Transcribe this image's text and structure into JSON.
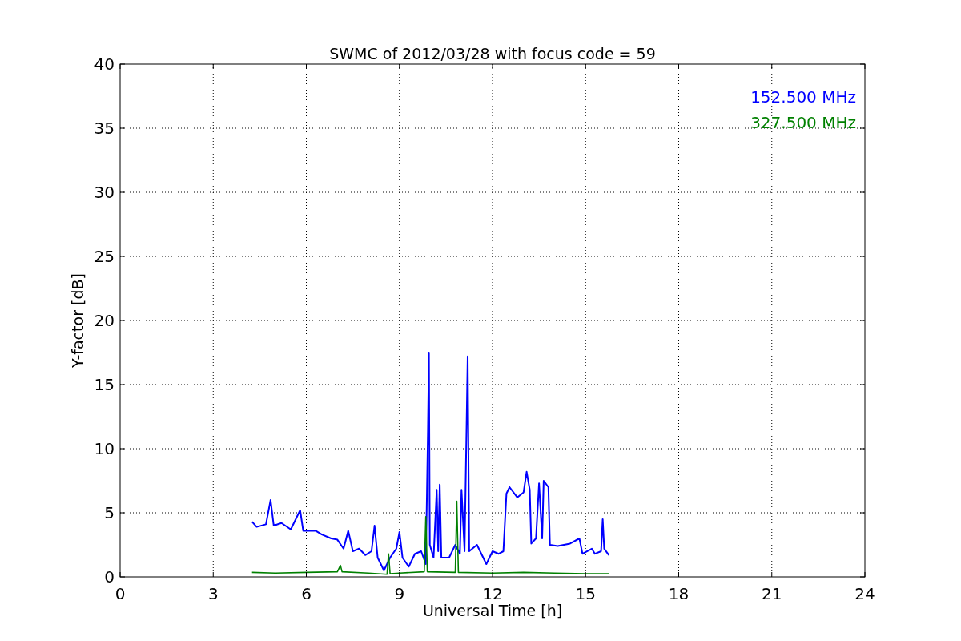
{
  "chart_data": {
    "type": "line",
    "title": "SWMC of 2012/03/28 with focus code = 59",
    "xlabel": "Universal Time [h]",
    "ylabel": "Y-factor [dB]",
    "xlim": [
      0,
      24
    ],
    "ylim": [
      0,
      40
    ],
    "xticks": [
      0,
      3,
      6,
      9,
      12,
      15,
      18,
      21,
      24
    ],
    "yticks": [
      0,
      5,
      10,
      15,
      20,
      25,
      30,
      35,
      40
    ],
    "grid": true,
    "series": [
      {
        "name": "152.500 MHz",
        "color": "#0000ff",
        "x": [
          4.25,
          4.4,
          4.7,
          4.85,
          4.95,
          5.2,
          5.5,
          5.8,
          5.9,
          6.3,
          6.5,
          6.8,
          7.0,
          7.2,
          7.35,
          7.5,
          7.7,
          7.9,
          8.1,
          8.2,
          8.3,
          8.5,
          8.7,
          8.9,
          9.0,
          9.1,
          9.3,
          9.5,
          9.7,
          9.85,
          9.92,
          9.95,
          9.98,
          10.1,
          10.2,
          10.25,
          10.3,
          10.35,
          10.6,
          10.8,
          10.95,
          11.0,
          11.1,
          11.2,
          11.25,
          11.5,
          11.8,
          12.0,
          12.2,
          12.35,
          12.45,
          12.55,
          12.8,
          13.0,
          13.1,
          13.2,
          13.25,
          13.4,
          13.5,
          13.6,
          13.65,
          13.8,
          13.85,
          14.1,
          14.5,
          14.8,
          14.9,
          15.2,
          15.3,
          15.5,
          15.55,
          15.6,
          15.75
        ],
        "values": [
          4.3,
          3.9,
          4.1,
          6.0,
          4.0,
          4.2,
          3.7,
          5.2,
          3.6,
          3.6,
          3.3,
          3.0,
          2.9,
          2.2,
          3.6,
          2.0,
          2.2,
          1.7,
          2.0,
          4.0,
          1.5,
          0.5,
          1.5,
          2.2,
          3.5,
          1.5,
          0.8,
          1.8,
          2.0,
          1.0,
          11.5,
          17.5,
          2.5,
          1.5,
          6.8,
          2.0,
          7.2,
          1.5,
          1.5,
          2.5,
          1.8,
          6.8,
          2.0,
          17.2,
          2.0,
          2.5,
          1.0,
          2.0,
          1.8,
          2.0,
          6.5,
          7.0,
          6.2,
          6.6,
          8.2,
          6.8,
          2.6,
          3.0,
          7.3,
          3.0,
          7.5,
          7.0,
          2.5,
          2.4,
          2.6,
          3.0,
          1.8,
          2.2,
          1.8,
          2.0,
          4.5,
          2.2,
          1.7
        ]
      },
      {
        "name": "327.500 MHz",
        "color": "#008000",
        "x": [
          4.25,
          5.0,
          6.0,
          7.0,
          7.1,
          7.15,
          8.0,
          8.6,
          8.65,
          8.7,
          9.0,
          9.8,
          9.85,
          9.9,
          10.8,
          10.85,
          10.9,
          12.0,
          13.0,
          14.0,
          15.0,
          15.75
        ],
        "values": [
          0.35,
          0.3,
          0.35,
          0.4,
          0.9,
          0.4,
          0.3,
          0.2,
          1.8,
          0.25,
          0.3,
          0.4,
          4.7,
          0.4,
          0.35,
          5.9,
          0.35,
          0.3,
          0.35,
          0.3,
          0.25,
          0.25
        ]
      }
    ]
  }
}
